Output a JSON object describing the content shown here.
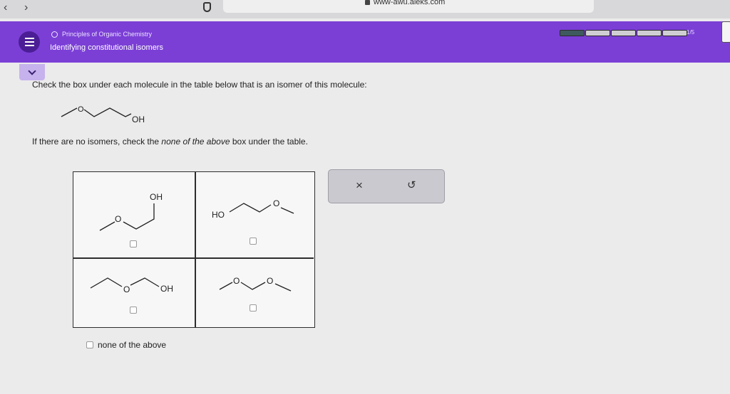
{
  "browser": {
    "url": "www-awu.aleks.com",
    "back": "‹",
    "forward": "›"
  },
  "header": {
    "topic": "Principles of Organic Chemistry",
    "title": "Identifying constitutional isomers",
    "progress": {
      "label": "1/5",
      "completed_fraction": 0.2
    }
  },
  "question": {
    "instruction": "Check the box under each molecule in the table below that is an isomer of this molecule:",
    "none_note_before": "If there are no isomers, check the ",
    "none_note_em": "none of the above",
    "none_note_after": " box under the table.",
    "target_labels": {
      "o": "O",
      "oh": "OH"
    }
  },
  "table": {
    "cells": [
      {
        "labels": {
          "top": "OH",
          "o": "O"
        },
        "checked": false
      },
      {
        "labels": {
          "ho": "HO",
          "o": "O"
        },
        "checked": false
      },
      {
        "labels": {
          "o": "O",
          "oh": "OH"
        },
        "checked": false
      },
      {
        "labels": {
          "o1": "O",
          "o2": "O"
        },
        "checked": false
      }
    ]
  },
  "answer_panel": {
    "clear": "×",
    "undo": "↺"
  },
  "none_of_above": "none of the above"
}
